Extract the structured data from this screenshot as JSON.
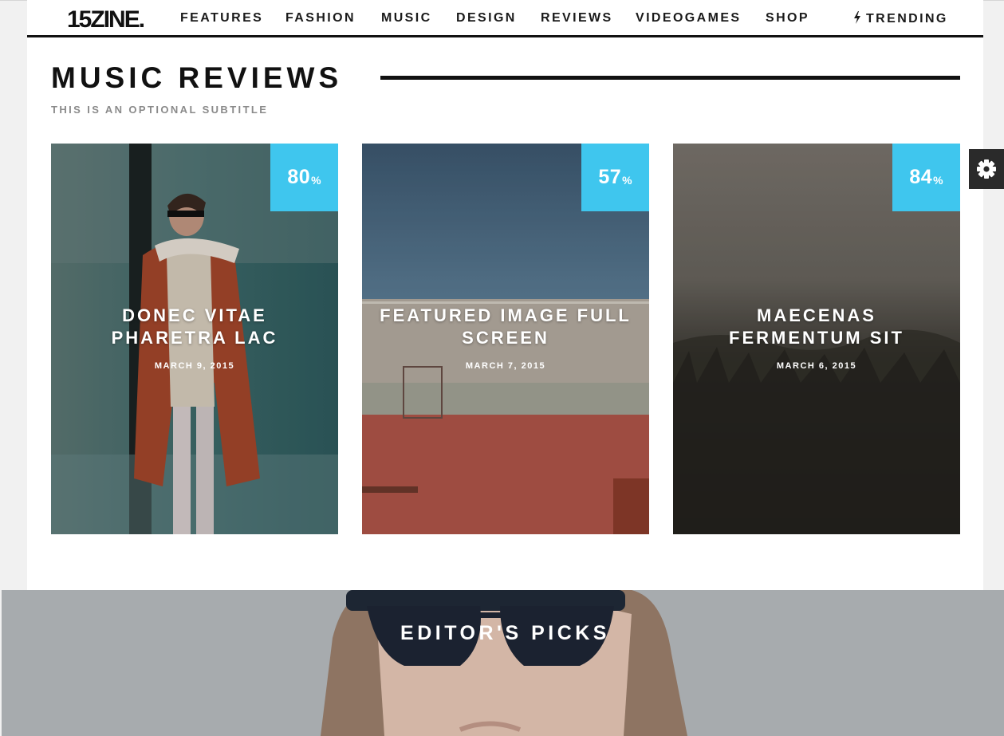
{
  "nav": {
    "logo": "15ZINE.",
    "items": [
      "FEATURES",
      "FASHION",
      "MUSIC",
      "DESIGN",
      "REVIEWS",
      "VIDEOGAMES",
      "SHOP"
    ],
    "trending": "TRENDING",
    "trending_icon": "lightning-bolt-icon"
  },
  "section": {
    "title": "MUSIC REVIEWS",
    "subtitle": "THIS IS AN OPTIONAL SUBTITLE"
  },
  "cards": [
    {
      "score": "80",
      "score_suffix": "%",
      "title": "DONEC VITAE PHARETRA LAC",
      "date": "MARCH 9, 2015"
    },
    {
      "score": "57",
      "score_suffix": "%",
      "title": "FEATURED IMAGE FULL SCREEN",
      "date": "MARCH 7, 2015"
    },
    {
      "score": "84",
      "score_suffix": "%",
      "title": "MAECENAS FERMENTUM SIT",
      "date": "MARCH 6, 2015"
    }
  ],
  "settings": {
    "icon": "gear-icon"
  },
  "editors_picks": {
    "title": "EDITOR'S PICKS"
  },
  "colors": {
    "accent": "#3fc6ee",
    "text_dark": "#111111",
    "subtitle": "#8a8a8a",
    "background": "#f1f1f1"
  }
}
